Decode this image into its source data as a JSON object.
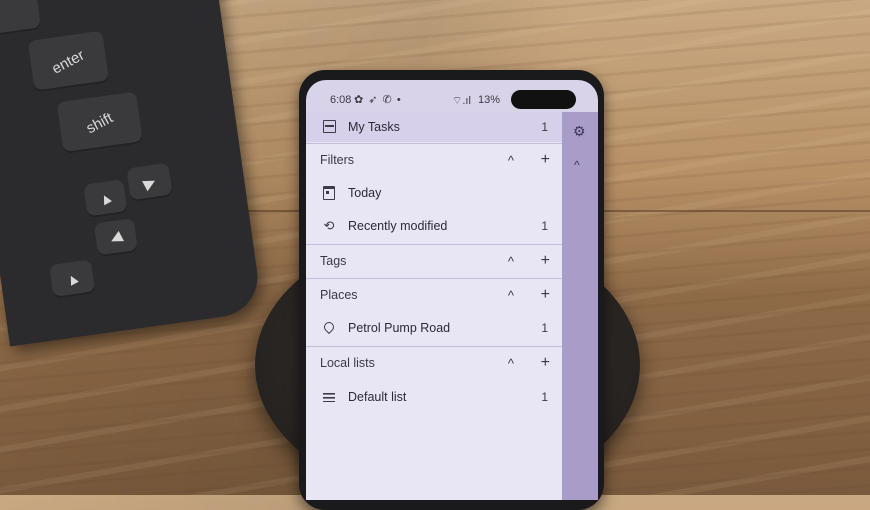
{
  "keyboard": {
    "keys": [
      "enter",
      "shift"
    ]
  },
  "statusbar": {
    "time": "6:08",
    "notif_icons": "✿ ➶ ✆ •",
    "system_icons": "⌔.ıl",
    "battery": "13%"
  },
  "drawer": {
    "my_tasks": {
      "label": "My Tasks",
      "count": "1",
      "icon": "task-list-icon"
    },
    "sections": [
      {
        "title": "Filters",
        "items": [
          {
            "label": "Today",
            "count": "",
            "icon": "calendar-icon"
          },
          {
            "label": "Recently modified",
            "count": "1",
            "icon": "history-icon"
          }
        ]
      },
      {
        "title": "Tags",
        "items": []
      },
      {
        "title": "Places",
        "items": [
          {
            "label": "Petrol Pump Road",
            "count": "1",
            "icon": "location-pin-icon"
          }
        ]
      },
      {
        "title": "Local lists",
        "items": [
          {
            "label": "Default list",
            "count": "1",
            "icon": "list-icon"
          }
        ]
      }
    ],
    "collapse_glyph": "^",
    "add_glyph": "+"
  },
  "side": {
    "settings_glyph": "⚙",
    "collapse_glyph": "^"
  }
}
